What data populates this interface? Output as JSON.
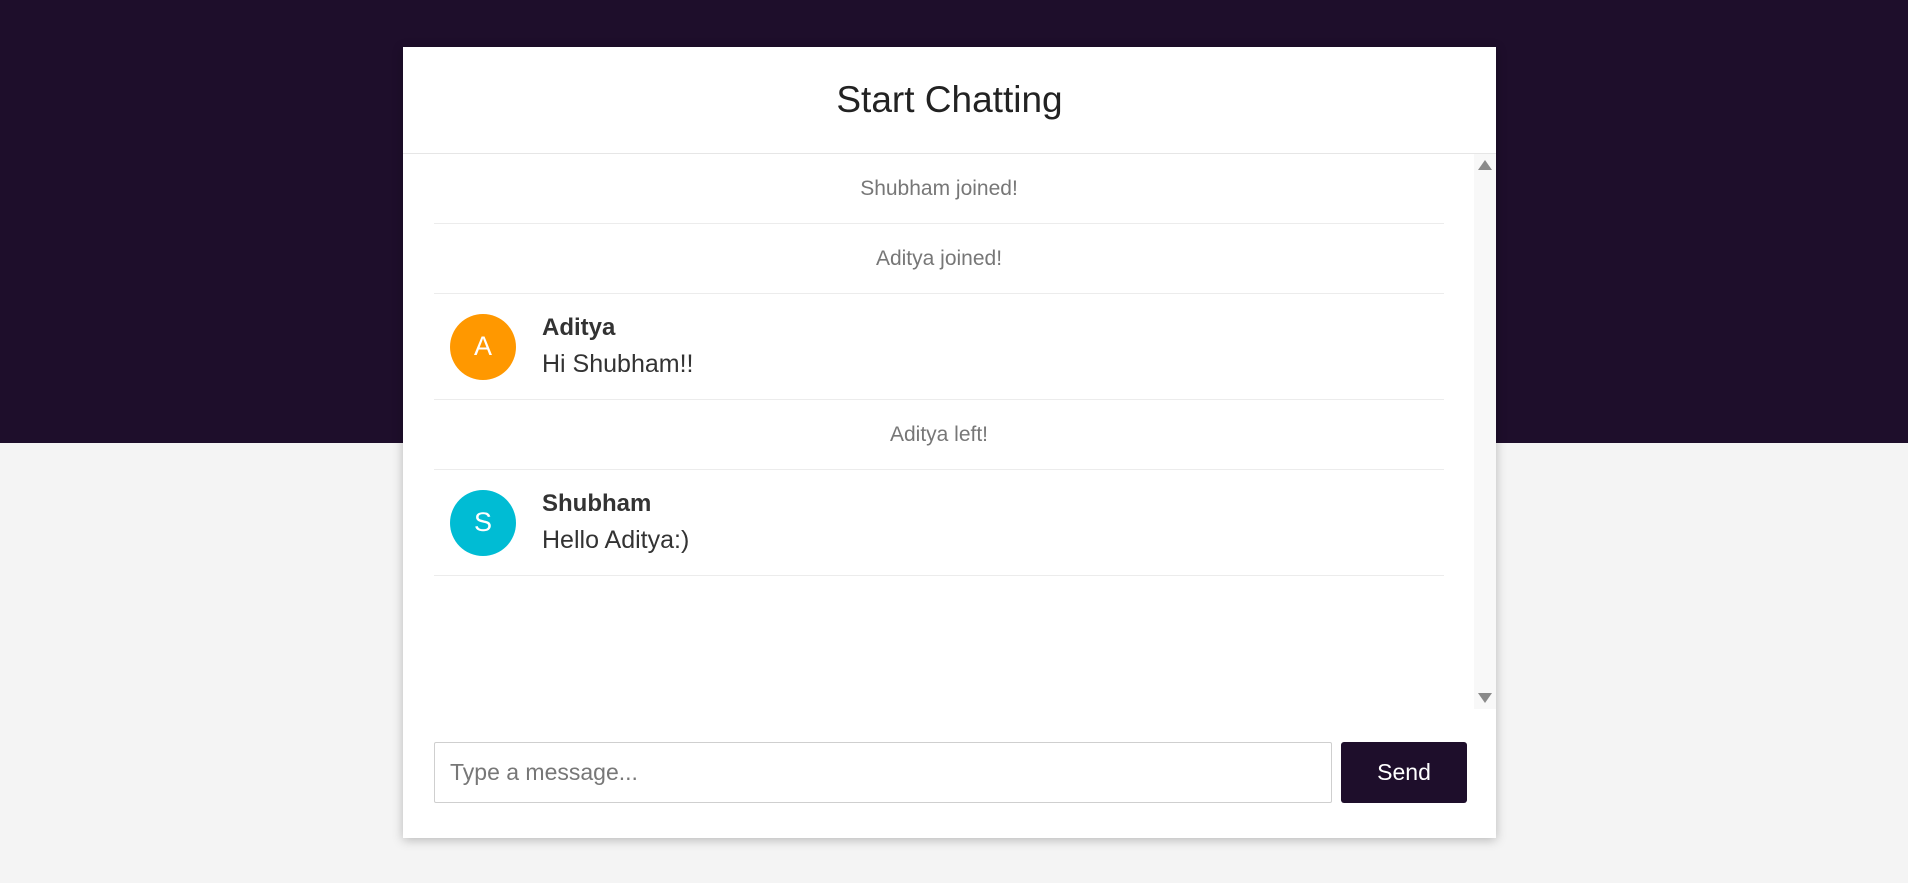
{
  "chat": {
    "title": "Start Chatting",
    "messages": [
      {
        "type": "notice",
        "text": "Shubham joined!"
      },
      {
        "type": "notice",
        "text": "Aditya joined!"
      },
      {
        "type": "user",
        "author": "Aditya",
        "initial": "A",
        "avatar_color": "#ff9800",
        "text": "Hi Shubham!!"
      },
      {
        "type": "notice",
        "text": "Aditya left!"
      },
      {
        "type": "user",
        "author": "Shubham",
        "initial": "S",
        "avatar_color": "#00bcd4",
        "text": "Hello Aditya:)"
      }
    ]
  },
  "composer": {
    "placeholder": "Type a message...",
    "value": "",
    "send_label": "Send"
  },
  "scrollbar": {
    "up_icon": "triangle-up-icon",
    "down_icon": "triangle-down-icon"
  },
  "colors": {
    "brand": "#1e0e2b",
    "background": "#f4f4f4"
  }
}
